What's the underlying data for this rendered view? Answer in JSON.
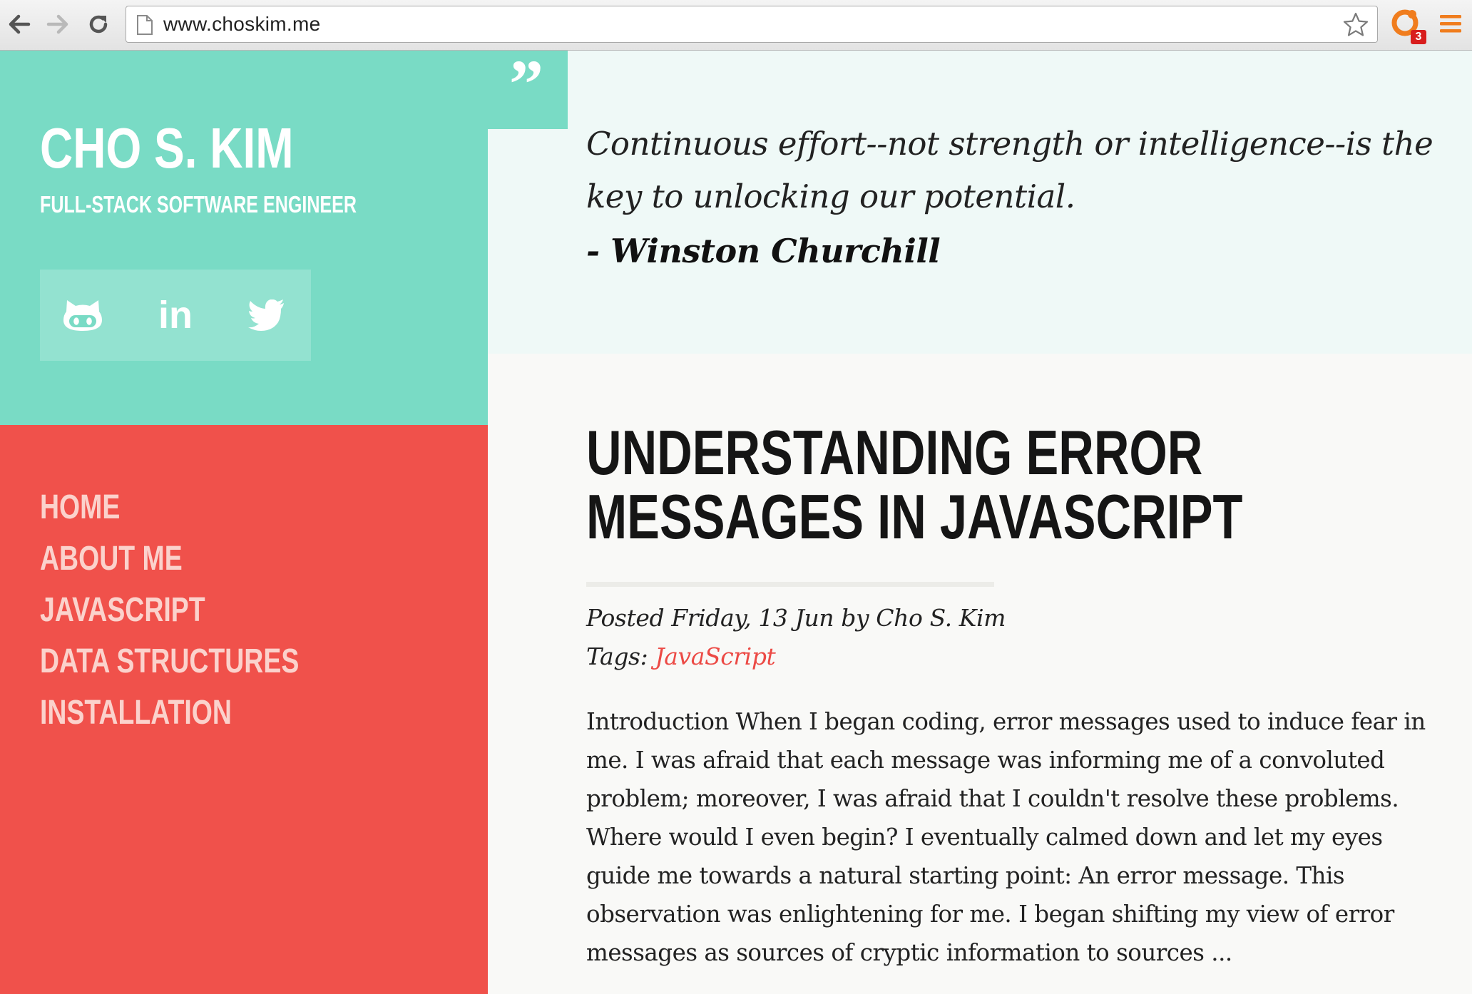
{
  "browser": {
    "url": "www.choskim.me",
    "extension_badge": "3",
    "icons": {
      "back": "back-arrow-icon",
      "forward": "forward-arrow-icon",
      "reload": "reload-icon",
      "page": "page-icon",
      "bookmark": "star-icon",
      "extension": "extension-icon",
      "menu": "hamburger-menu-icon"
    }
  },
  "sidebar": {
    "title": "CHO S. KIM",
    "subtitle": "FULL-STACK SOFTWARE ENGINEER",
    "social": {
      "github_icon": "github-icon",
      "linkedin_label": "in",
      "twitter_icon": "twitter-icon"
    },
    "nav": [
      {
        "label": "HOME"
      },
      {
        "label": "ABOUT ME"
      },
      {
        "label": "JAVASCRIPT"
      },
      {
        "label": "DATA STRUCTURES"
      },
      {
        "label": "INSTALLATION"
      }
    ]
  },
  "quote": {
    "mark": "”",
    "text": "Continuous effort--not strength or intelligence--is the key to unlocking our potential.",
    "author": "- Winston Churchill"
  },
  "post": {
    "title_line1": "UNDERSTANDING ERROR",
    "title_line2": "MESSAGES IN JAVASCRIPT",
    "meta": "Posted Friday, 13 Jun by Cho S. Kim",
    "tags_label": "Tags: ",
    "tag": "JavaScript",
    "excerpt": "Introduction When I began coding, error messages used to induce fear in me. I was afraid that each message was informing me of a convoluted problem; moreover, I was afraid that I couldn't resolve these problems. Where would I even begin? I eventually calmed down and let my eyes guide me towards a natural starting point: An error message. This observation was enlightening for me. I began shifting my view of error messages as sources of cryptic information to sources ..."
  },
  "colors": {
    "teal": "#79dbc5",
    "coral": "#f0514b",
    "nav_text": "#fbd2cc",
    "quote_bg": "#eff9f7",
    "tag_link": "#ec4a45"
  }
}
